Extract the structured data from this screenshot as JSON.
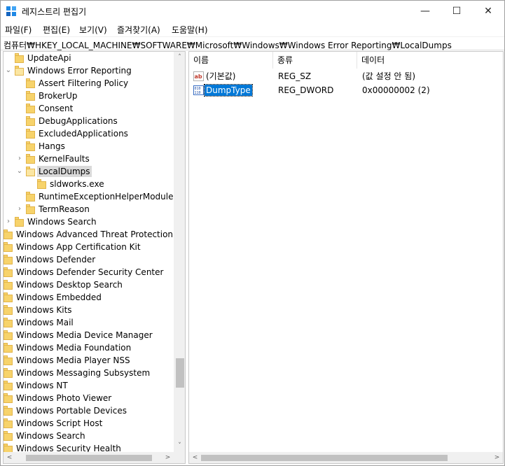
{
  "window": {
    "title": "레지스트리 편집기",
    "minimize_glyph": "—",
    "maximize_glyph": "☐",
    "close_glyph": "✕"
  },
  "menu": [
    {
      "label": "파일(F)"
    },
    {
      "label": "편집(E)"
    },
    {
      "label": "보기(V)"
    },
    {
      "label": "즐겨찾기(A)"
    },
    {
      "label": "도움말(H)"
    }
  ],
  "address": {
    "path": "컴퓨터₩HKEY_LOCAL_MACHINE₩SOFTWARE₩Microsoft₩Windows₩Windows Error Reporting₩LocalDumps"
  },
  "tree": {
    "items": [
      {
        "label": "UpdateApi",
        "chevron": ""
      },
      {
        "label": "Windows Error Reporting",
        "chevron": "⌄"
      },
      {
        "label": "Assert Filtering Policy",
        "chevron": ""
      },
      {
        "label": "BrokerUp",
        "chevron": ""
      },
      {
        "label": "Consent",
        "chevron": ""
      },
      {
        "label": "DebugApplications",
        "chevron": ""
      },
      {
        "label": "ExcludedApplications",
        "chevron": ""
      },
      {
        "label": "Hangs",
        "chevron": ""
      },
      {
        "label": "KernelFaults",
        "chevron": "›"
      },
      {
        "label": "LocalDumps",
        "chevron": "⌄"
      },
      {
        "label": "sldworks.exe",
        "chevron": ""
      },
      {
        "label": "RuntimeExceptionHelperModules",
        "chevron": ""
      },
      {
        "label": "TermReason",
        "chevron": "›"
      },
      {
        "label": "Windows Search",
        "chevron": "›"
      },
      {
        "label": "Windows Advanced Threat Protection",
        "chevron": "›"
      },
      {
        "label": "Windows App Certification Kit",
        "chevron": "›"
      },
      {
        "label": "Windows Defender",
        "chevron": "›"
      },
      {
        "label": "Windows Defender Security Center",
        "chevron": "›"
      },
      {
        "label": "Windows Desktop Search",
        "chevron": "›"
      },
      {
        "label": "Windows Embedded",
        "chevron": "›"
      },
      {
        "label": "Windows Kits",
        "chevron": "›"
      },
      {
        "label": "Windows Mail",
        "chevron": "›"
      },
      {
        "label": "Windows Media Device Manager",
        "chevron": "›"
      },
      {
        "label": "Windows Media Foundation",
        "chevron": "›"
      },
      {
        "label": "Windows Media Player NSS",
        "chevron": "›"
      },
      {
        "label": "Windows Messaging Subsystem",
        "chevron": "›"
      },
      {
        "label": "Windows NT",
        "chevron": "›"
      },
      {
        "label": "Windows Photo Viewer",
        "chevron": "›"
      },
      {
        "label": "Windows Portable Devices",
        "chevron": "›"
      },
      {
        "label": "Windows Script Host",
        "chevron": "›"
      },
      {
        "label": "Windows Search",
        "chevron": "›"
      },
      {
        "label": "Windows Security Health",
        "chevron": "›"
      }
    ],
    "scroll_up": "˄",
    "scroll_down": "˅",
    "scroll_left": "<",
    "scroll_right": ">"
  },
  "values": {
    "columns": [
      "이름",
      "종류",
      "데이터"
    ],
    "rows": [
      {
        "name": "(기본값)",
        "type": "REG_SZ",
        "data": "(값 설정 안 됨)",
        "icon": "string-value-icon"
      },
      {
        "name": "DumpType",
        "type": "REG_DWORD",
        "data": "0x00000002 (2)",
        "icon": "dword-value-icon"
      }
    ]
  }
}
